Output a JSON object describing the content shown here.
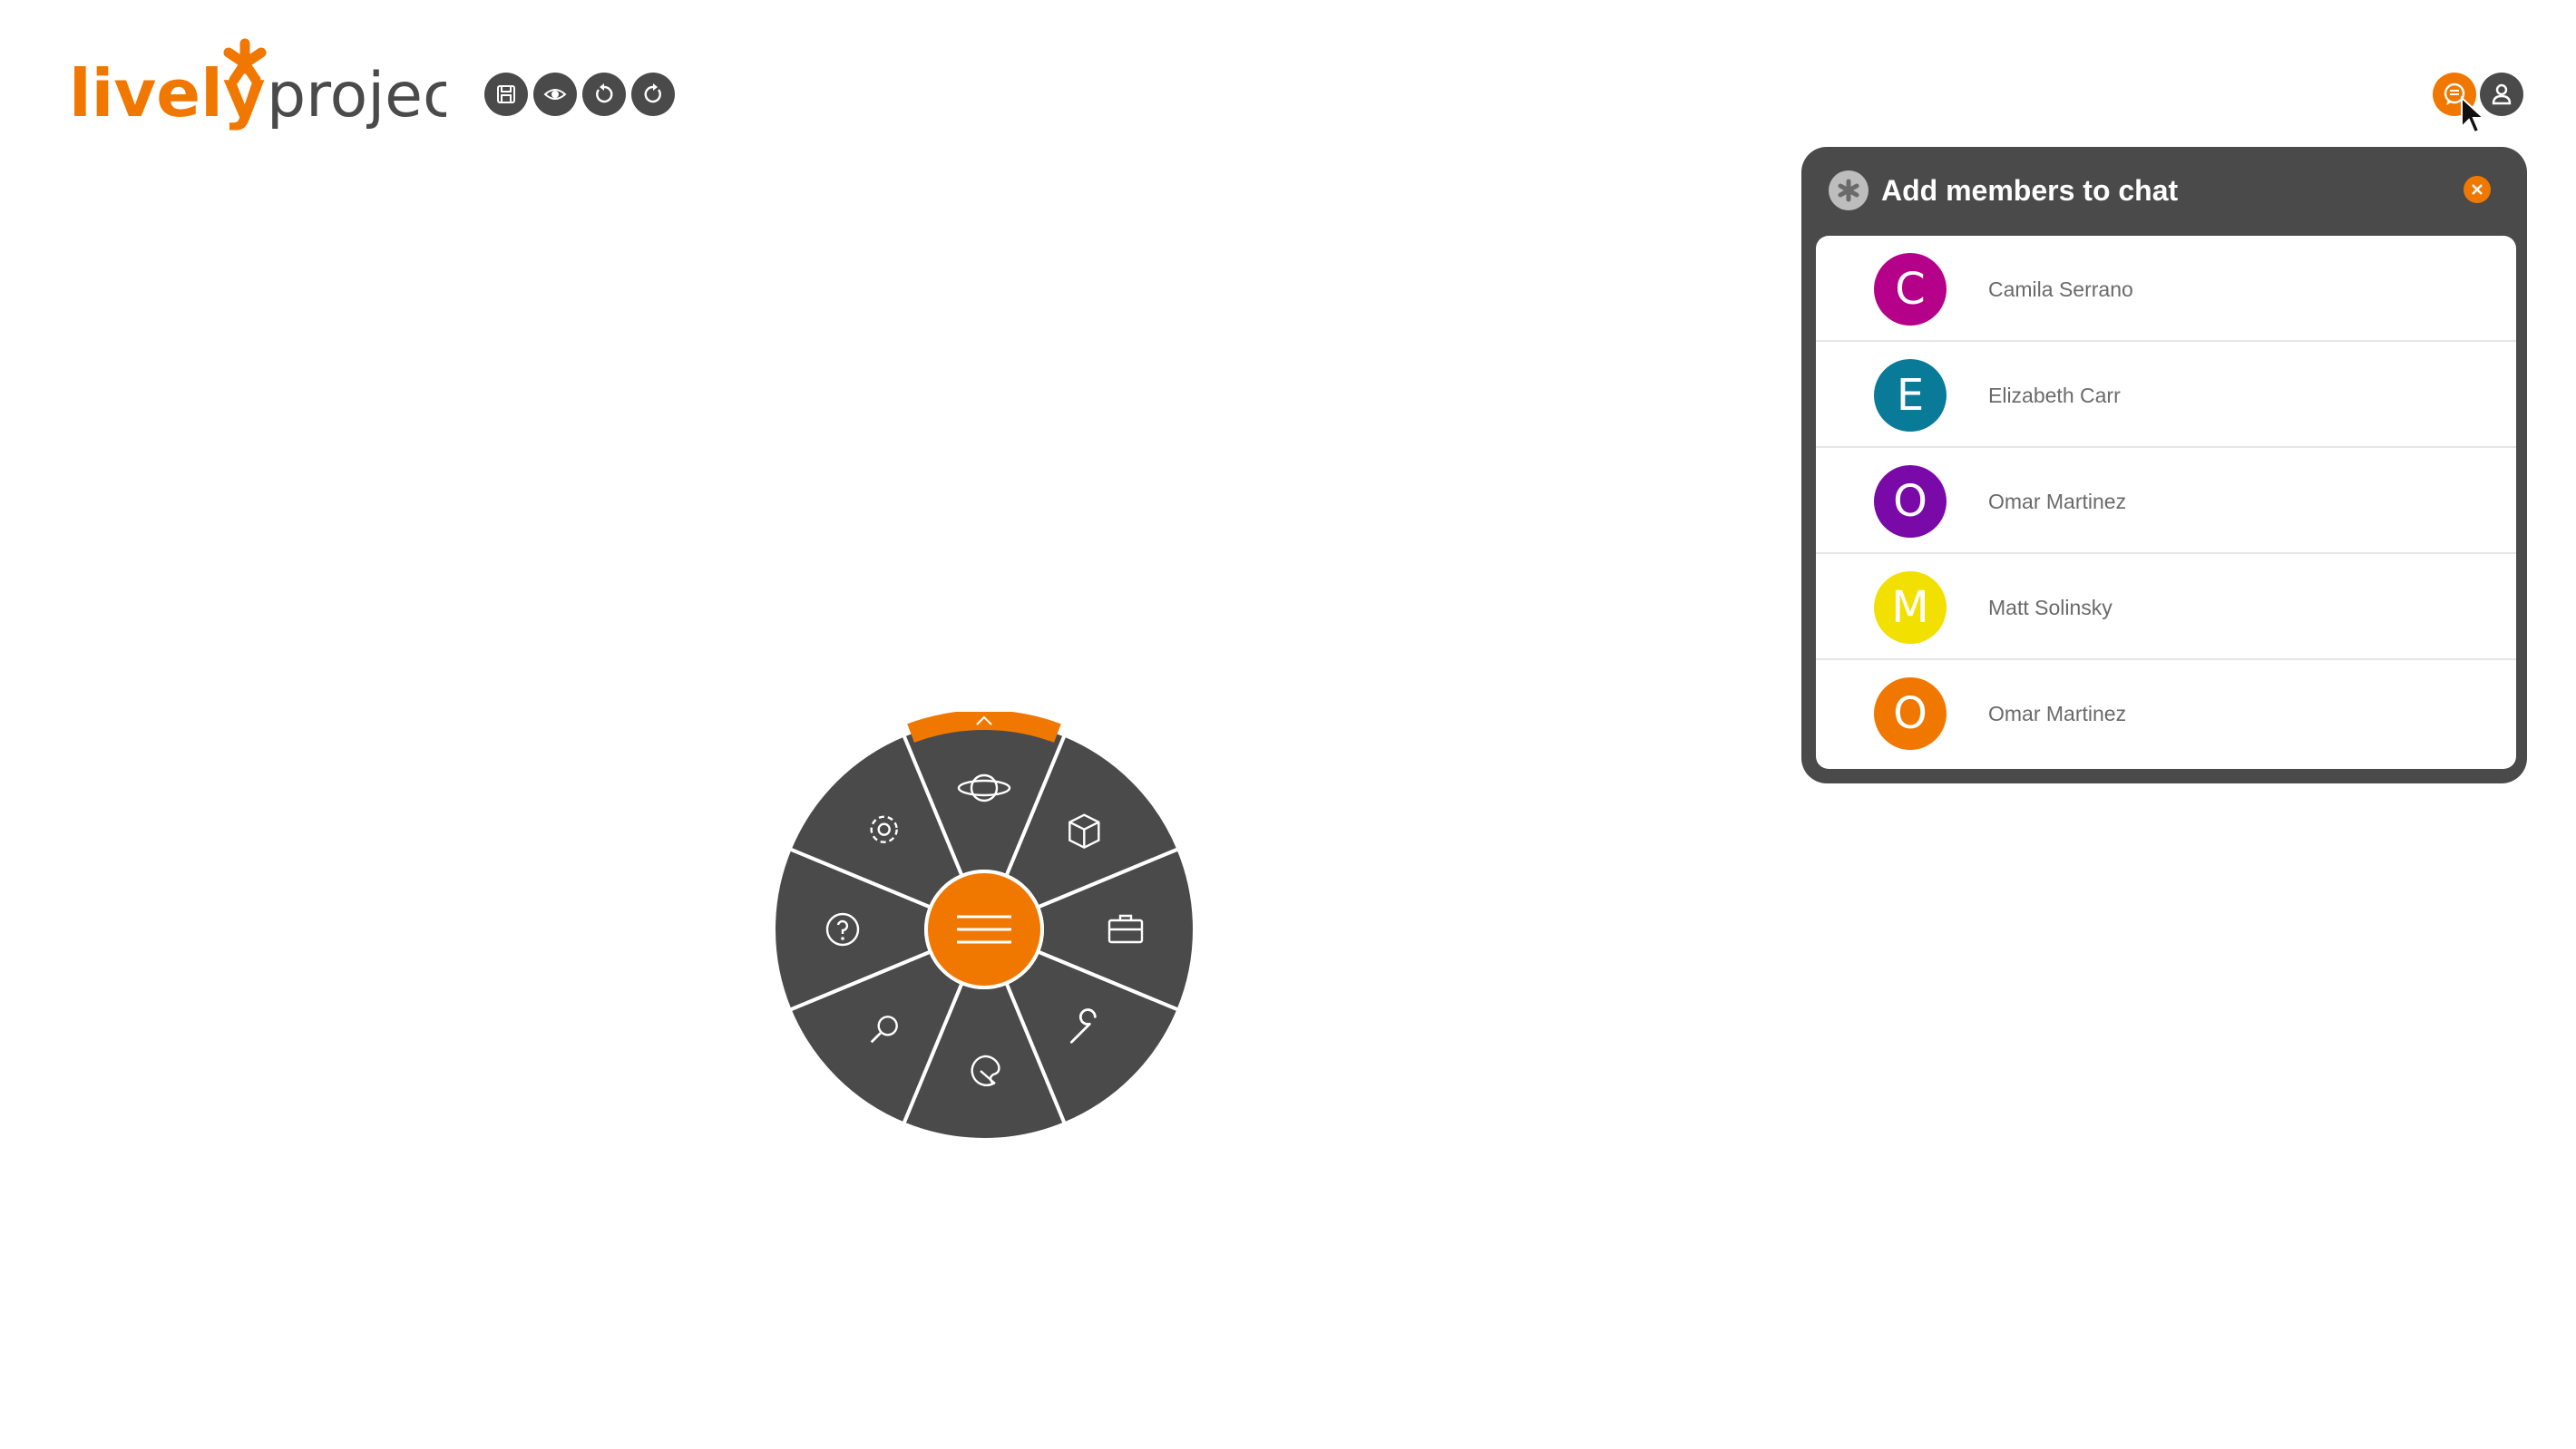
{
  "logo": {
    "word1": "lively",
    "word2": "project",
    "accent_color": "#f07800",
    "text_color": "#4a4a4a"
  },
  "toolbar": {
    "buttons": [
      {
        "name": "save",
        "icon": "floppy-disk-icon"
      },
      {
        "name": "preview",
        "icon": "eye-icon"
      },
      {
        "name": "undo",
        "icon": "undo-icon"
      },
      {
        "name": "redo",
        "icon": "redo-icon"
      }
    ]
  },
  "top_right": {
    "chat_icon": "chat-bubble-icon",
    "user_icon": "user-icon"
  },
  "chat_panel": {
    "title": "Add members to chat",
    "close_icon": "close-icon",
    "members": [
      {
        "initial": "C",
        "name": "Camila Serrano",
        "color": "#b5008a"
      },
      {
        "initial": "E",
        "name": "Elizabeth Carr",
        "color": "#0a7a99"
      },
      {
        "initial": "O",
        "name": "Omar Martinez",
        "color": "#7a0aa8"
      },
      {
        "initial": "M",
        "name": "Matt Solinsky",
        "color": "#f2e000"
      },
      {
        "initial": "O",
        "name": "Omar Martinez",
        "color": "#f07800"
      }
    ]
  },
  "radial_menu": {
    "center_icon": "hamburger-menu-icon",
    "items": [
      {
        "name": "world",
        "icon": "planet-icon",
        "active": true
      },
      {
        "name": "objects",
        "icon": "box-icon"
      },
      {
        "name": "toolbox",
        "icon": "briefcase-icon"
      },
      {
        "name": "tools",
        "icon": "wrench-icon"
      },
      {
        "name": "style",
        "icon": "palette-icon"
      },
      {
        "name": "search",
        "icon": "search-icon"
      },
      {
        "name": "help",
        "icon": "help-icon"
      },
      {
        "name": "settings",
        "icon": "gear-icon"
      }
    ],
    "colors": {
      "segment": "#4a4a4a",
      "accent": "#f07800",
      "line": "#ffffff"
    }
  }
}
